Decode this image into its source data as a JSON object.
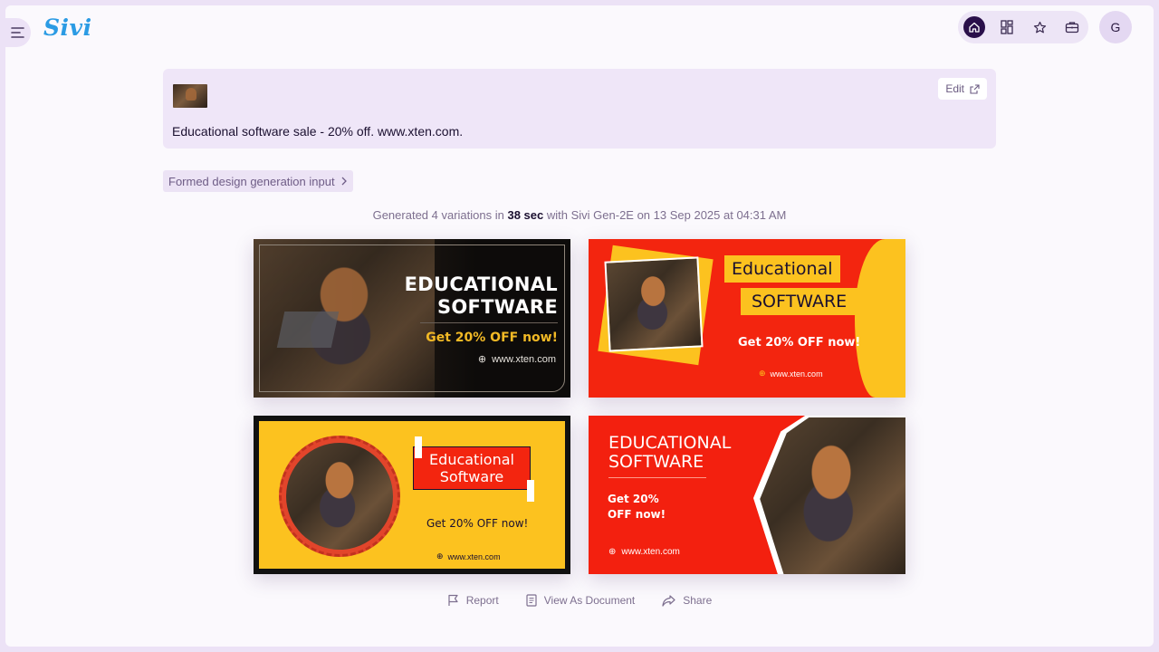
{
  "header": {
    "logo": "Sivi",
    "avatar_initial": "G",
    "icons": [
      "menu-icon",
      "home-icon",
      "grid-icon",
      "star-icon",
      "briefcase-icon"
    ]
  },
  "prompt": {
    "text": "Educational software sale - 20% off. www.xten.com.",
    "edit_label": "Edit"
  },
  "formed_input_label": "Formed design generation input",
  "generation": {
    "prefix": "Generated 4 variations in",
    "duration": "38 sec",
    "suffix": "with Sivi Gen-2E on 13 Sep 2025 at 04:31 AM"
  },
  "banners": [
    {
      "title_line1": "EDUCATIONAL",
      "title_line2": "SOFTWARE",
      "offer": "Get 20% OFF now!",
      "url": "www.xten.com"
    },
    {
      "title_line1": "Educational",
      "title_line2": "SOFTWARE",
      "offer": "Get 20% OFF now!",
      "url": "www.xten.com"
    },
    {
      "title_line1": "Educational",
      "title_line2": "Software",
      "offer": "Get 20% OFF now!",
      "url": "www.xten.com"
    },
    {
      "title_line1": "EDUCATIONAL",
      "title_line2": "SOFTWARE",
      "offer_line1": "Get 20%",
      "offer_line2": "OFF now!",
      "url": "www.xten.com"
    }
  ],
  "actions": {
    "report": "Report",
    "view_document": "View As Document",
    "share": "Share"
  },
  "colors": {
    "accent": "#2a0f4a",
    "logo": "#2b9be4",
    "red": "#f3250f",
    "yellow": "#fcc21f"
  }
}
